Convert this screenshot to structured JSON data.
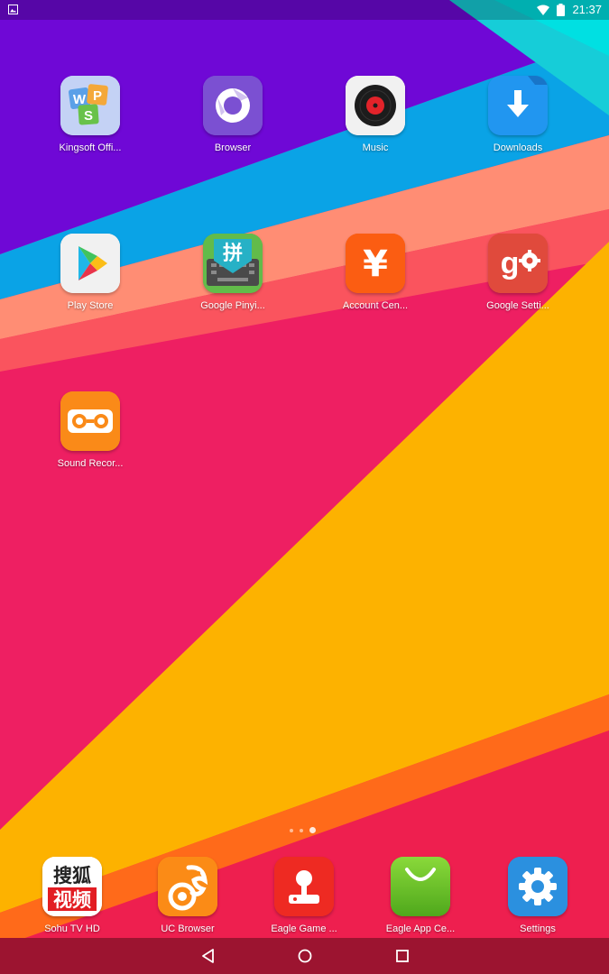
{
  "status_bar": {
    "time": "21:37",
    "icons": [
      "picture-icon",
      "wifi-icon",
      "battery-icon"
    ]
  },
  "apps": [
    {
      "label": "Kingsoft Offi...",
      "icon": "wps-office-icon"
    },
    {
      "label": "Browser",
      "icon": "browser-icon"
    },
    {
      "label": "Music",
      "icon": "music-icon"
    },
    {
      "label": "Downloads",
      "icon": "downloads-icon"
    },
    {
      "label": "Play Store",
      "icon": "play-store-icon"
    },
    {
      "label": "Google Pinyi...",
      "icon": "google-pinyin-icon"
    },
    {
      "label": "Account Cen...",
      "icon": "account-center-icon"
    },
    {
      "label": "Google Setti...",
      "icon": "google-settings-icon"
    },
    {
      "label": "Sound Recor...",
      "icon": "sound-recorder-icon"
    }
  ],
  "dock": [
    {
      "label": "Sohu TV HD",
      "icon": "sohu-tv-icon"
    },
    {
      "label": "UC Browser",
      "icon": "uc-browser-icon"
    },
    {
      "label": "Eagle Game ...",
      "icon": "eagle-game-icon"
    },
    {
      "label": "Eagle App Ce...",
      "icon": "eagle-app-center-icon"
    },
    {
      "label": "Settings",
      "icon": "settings-icon"
    }
  ],
  "glyphs": {
    "pinyin": "拼",
    "yen": "¥",
    "sohu_line1": "搜狐",
    "sohu_line2": "视频"
  },
  "page_indicator": {
    "count": 3,
    "active": 3
  },
  "navigation": {
    "buttons": [
      "back-icon",
      "home-icon",
      "recents-icon"
    ]
  },
  "colors": {
    "status_bar": "#4a0a8c",
    "nav_bar": "#9c1430",
    "wallpaper_purple": "#6f08d6",
    "wallpaper_pink": "#ee1f62",
    "wallpaper_yellow": "#fdb200",
    "wallpaper_blue": "#0aa3e6"
  }
}
